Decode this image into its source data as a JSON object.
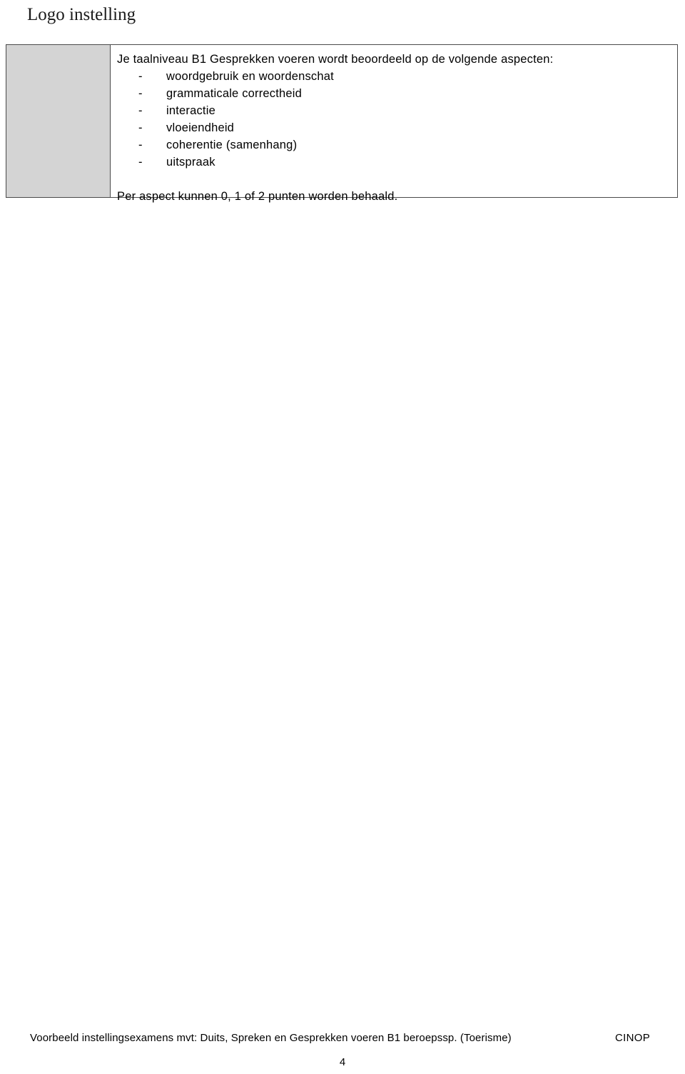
{
  "document": {
    "title": "Logo instelling",
    "page_number": "4"
  },
  "assessment_table": {
    "left_cell": {
      "label": "",
      "fill_color": "#d4d4d4"
    },
    "right_cell": {
      "intro": "Je taalniveau B1 Gesprekken voeren wordt beoordeeld op de volgende aspecten:",
      "dash": "-",
      "aspects": [
        "woordgebruik en woordenschat",
        "grammaticale correctheid",
        "interactie",
        "vloeiendheid",
        "coherentie (samenhang)",
        "uitspraak"
      ],
      "scoring": "Per aspect kunnen 0, 1 of 2 punten worden behaald."
    },
    "border_color": "#4a4a4a"
  },
  "footer": {
    "text": "Voorbeeld instellingsexamens mvt: Duits, Spreken en Gesprekken voeren B1 beroepssp. (Toerisme)",
    "brand": "CINOP"
  }
}
